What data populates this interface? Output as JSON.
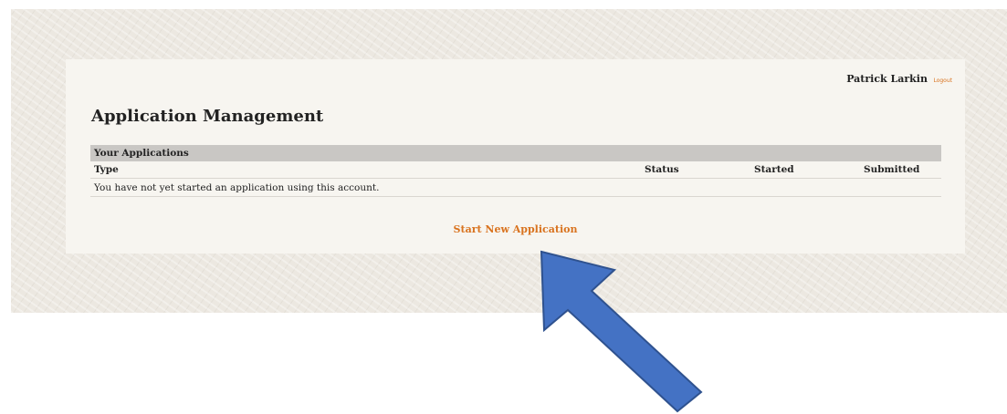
{
  "header": {
    "user_name": "Patrick Larkin",
    "logout_label": "Logout"
  },
  "page": {
    "title": "Application Management"
  },
  "applications_table": {
    "section_title": "Your Applications",
    "columns": [
      "Type",
      "Status",
      "Started",
      "Submitted"
    ],
    "empty_message": "You have not yet started an application using this account."
  },
  "actions": {
    "start_new_label": "Start New Application"
  },
  "colors": {
    "accent": "#d9731f",
    "arrow_fill": "#4472c4",
    "arrow_stroke": "#2f528f",
    "table_header_bg": "#c9c7c4"
  },
  "annotation": {
    "icon": "arrow-up-left-icon"
  }
}
